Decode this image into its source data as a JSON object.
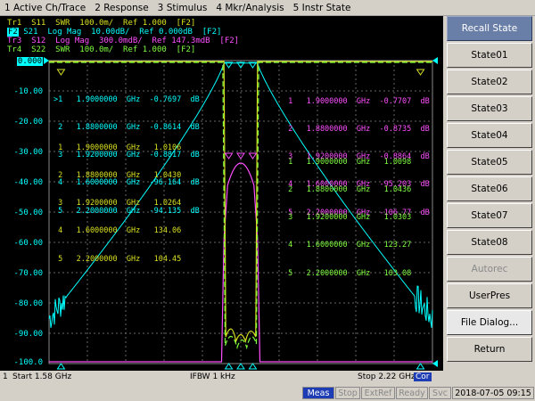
{
  "menu": [
    "1 Active Ch/Trace",
    "2 Response",
    "3 Stimulus",
    "4 Mkr/Analysis",
    "5 Instr State"
  ],
  "traces": [
    {
      "label": "Tr1  S11  SWR  100.0m/  Ref 1.000  [F2]",
      "color": "#d8e020"
    },
    {
      "label": "S21  Log Mag  10.00dB/  Ref 0.000dB  [F2]",
      "tag": "F2",
      "color": "#00ffff"
    },
    {
      "label": "Tr3  S12  Log Mag  300.0mdB/  Ref 147.3mdB  [F2]",
      "color": "#ff50ff"
    },
    {
      "label": "Tr4  S22  SWR  100.0m/  Ref 1.000  [F2]",
      "color": "#80ff40"
    }
  ],
  "y_axis": {
    "ref": "0.000",
    "ticks": [
      "-10.00",
      "-20.00",
      "-30.00",
      "-40.00",
      "-50.00",
      "-60.00",
      "-70.00",
      "-80.00",
      "-90.00",
      "-100.0"
    ]
  },
  "markers_s21": [
    ">1   1.9000000  GHz  -0.7697  dB",
    " 2   1.8800000  GHz  -0.8614  dB",
    " 3   1.9200000  GHz  -0.8817  dB",
    " 4   1.6000000  GHz  -96.164  dB",
    " 5   2.2000000  GHz  -94.135  dB"
  ],
  "markers_s11": [
    " 1   1.9000000  GHz   1.0106",
    " 2   1.8800000  GHz   1.0430",
    " 3   1.9200000  GHz   1.0264",
    " 4   1.6000000  GHz   134.06",
    " 5   2.2000000  GHz   104.45"
  ],
  "markers_s12": [
    " 1   1.9000000  GHz  -0.7707  dB",
    " 2   1.8800000  GHz  -0.8735  dB",
    " 3   1.9200000  GHz  -0.8864  dB",
    " 4   1.6000000  GHz  -95.203  dB",
    " 5   2.2000000  GHz  -106.77  dB"
  ],
  "markers_s22": [
    " 1   1.9000000  GHz   1.0098",
    " 2   1.8800000  GHz   1.0436",
    " 3   1.9200000  GHz   1.0303",
    " 4   1.6000000  GHz   123.27",
    " 5   2.2000000  GHz   103.08"
  ],
  "sidebar": [
    "Recall State",
    "State01",
    "State02",
    "State03",
    "State04",
    "State05",
    "State06",
    "State07",
    "State08",
    "Autorec",
    "UserPres",
    "File Dialog...",
    "Return"
  ],
  "bottom": {
    "channel": "1",
    "start": "Start 1.58 GHz",
    "ifbw": "IFBW 1 kHz",
    "stop": "Stop 2.22 GHz",
    "cor": "Cor"
  },
  "status": {
    "meas": "Meas",
    "stop": "Stop",
    "extref": "ExtRef",
    "ready": "Ready",
    "svc": "Svc",
    "datetime": "2018-07-05 09:15"
  },
  "colors": {
    "s11": "#d8e020",
    "s21": "#00ffff",
    "s12": "#ff50ff",
    "s22": "#80ff40",
    "grid": "#666666"
  }
}
